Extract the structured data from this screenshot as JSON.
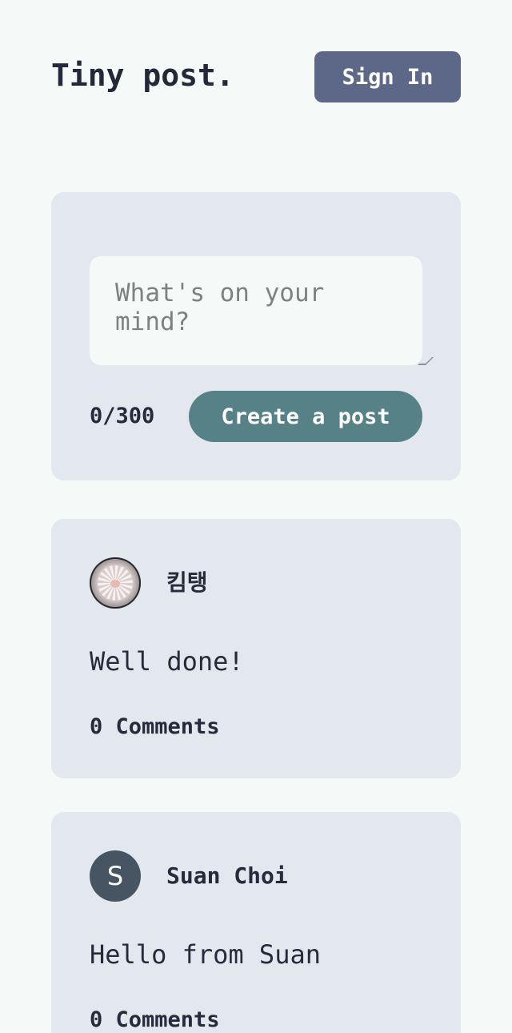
{
  "header": {
    "logo": "Tiny post.",
    "sign_in_label": "Sign In"
  },
  "composer": {
    "placeholder": "What's on your mind?",
    "counter": "0/300",
    "create_label": "Create a post"
  },
  "posts": [
    {
      "author": "킴탱",
      "avatar": "flower-photo",
      "text": "Well done!",
      "comments": "0 Comments"
    },
    {
      "author": "Suan Choi",
      "avatar_letter": "S",
      "text": "Hello from Suan",
      "comments": "0 Comments"
    }
  ],
  "colors": {
    "background": "#f5faf9",
    "card": "#e3e7ee",
    "sign_in_button": "#5d6889",
    "create_button": "#568187",
    "avatar_letter_bg": "#475562",
    "text": "#262a3b"
  }
}
